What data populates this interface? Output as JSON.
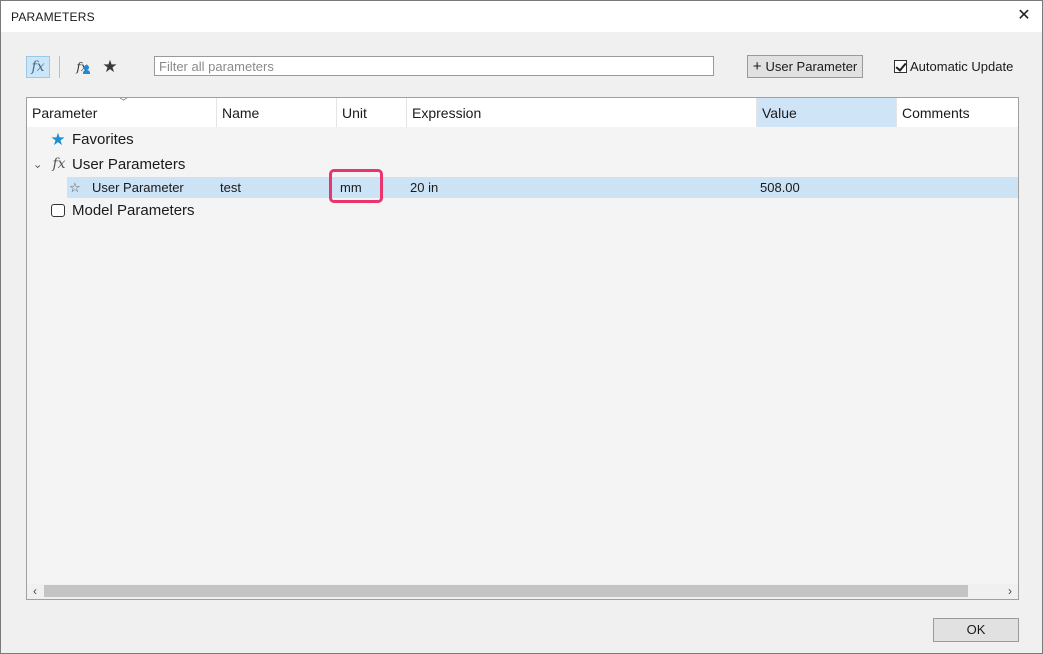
{
  "window": {
    "title": "PARAMETERS",
    "close_glyph": "✕"
  },
  "toolbar": {
    "all_params_icon": "fx-icon",
    "all_params_glyph": "fx",
    "user_params_icon": "fx-user-icon",
    "user_params_glyph": "fx",
    "favorites_icon": "star-icon",
    "favorites_glyph": "★",
    "filter_placeholder": "Filter all parameters",
    "filter_value": "",
    "add_button_plus": "+",
    "add_button_label": "User Parameter",
    "auto_update_label": "Automatic Update",
    "auto_update_checked": true
  },
  "grid": {
    "columns": [
      "Parameter",
      "Name",
      "Unit",
      "Expression",
      "Value",
      "Comments"
    ],
    "groups": {
      "favorites": {
        "label": "Favorites",
        "icon_glyph": "★"
      },
      "user": {
        "label": "User Parameters",
        "chevron": "›",
        "icon_glyph": "fx"
      },
      "model": {
        "label": "Model Parameters"
      }
    },
    "user_rows": [
      {
        "star_glyph": "☆",
        "parameter": "User Parameter",
        "name": "test",
        "unit": "mm",
        "expression": "20 in",
        "value": "508.00",
        "comments": ""
      }
    ],
    "scroll_left": "‹",
    "scroll_right": "›"
  },
  "footer": {
    "ok_label": "OK"
  },
  "colors": {
    "accent_blue": "#1a8fd3",
    "selection": "#cce3f6",
    "highlight_box": "#e8356d"
  }
}
